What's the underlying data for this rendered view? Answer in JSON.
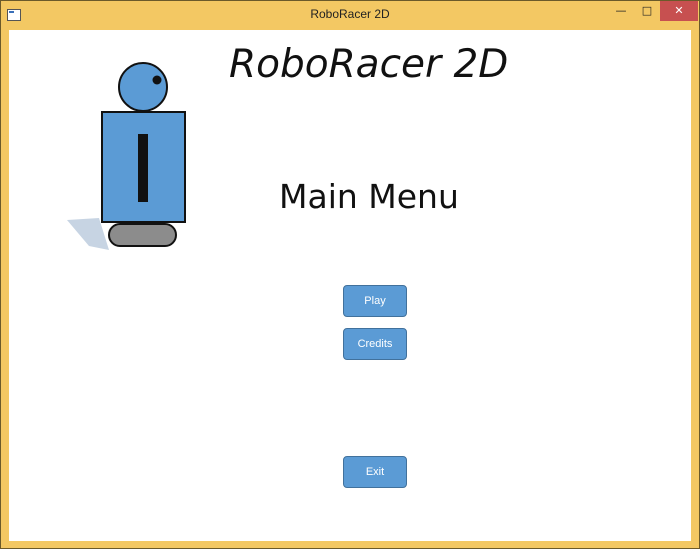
{
  "window": {
    "title": "RoboRacer 2D",
    "controls": {
      "minimize": "—",
      "maximize": "□",
      "close": "✕"
    }
  },
  "game": {
    "title": "RoboRacer 2D",
    "heading": "Main Menu",
    "buttons": {
      "play": "Play",
      "credits": "Credits",
      "exit": "Exit"
    }
  },
  "colors": {
    "window_frame": "#f3c863",
    "button_fill": "#5b9bd5",
    "robot_body": "#5b9bd5",
    "robot_wheel": "#8c8c8c"
  },
  "icons": [
    "app-icon",
    "robot-sprite"
  ]
}
